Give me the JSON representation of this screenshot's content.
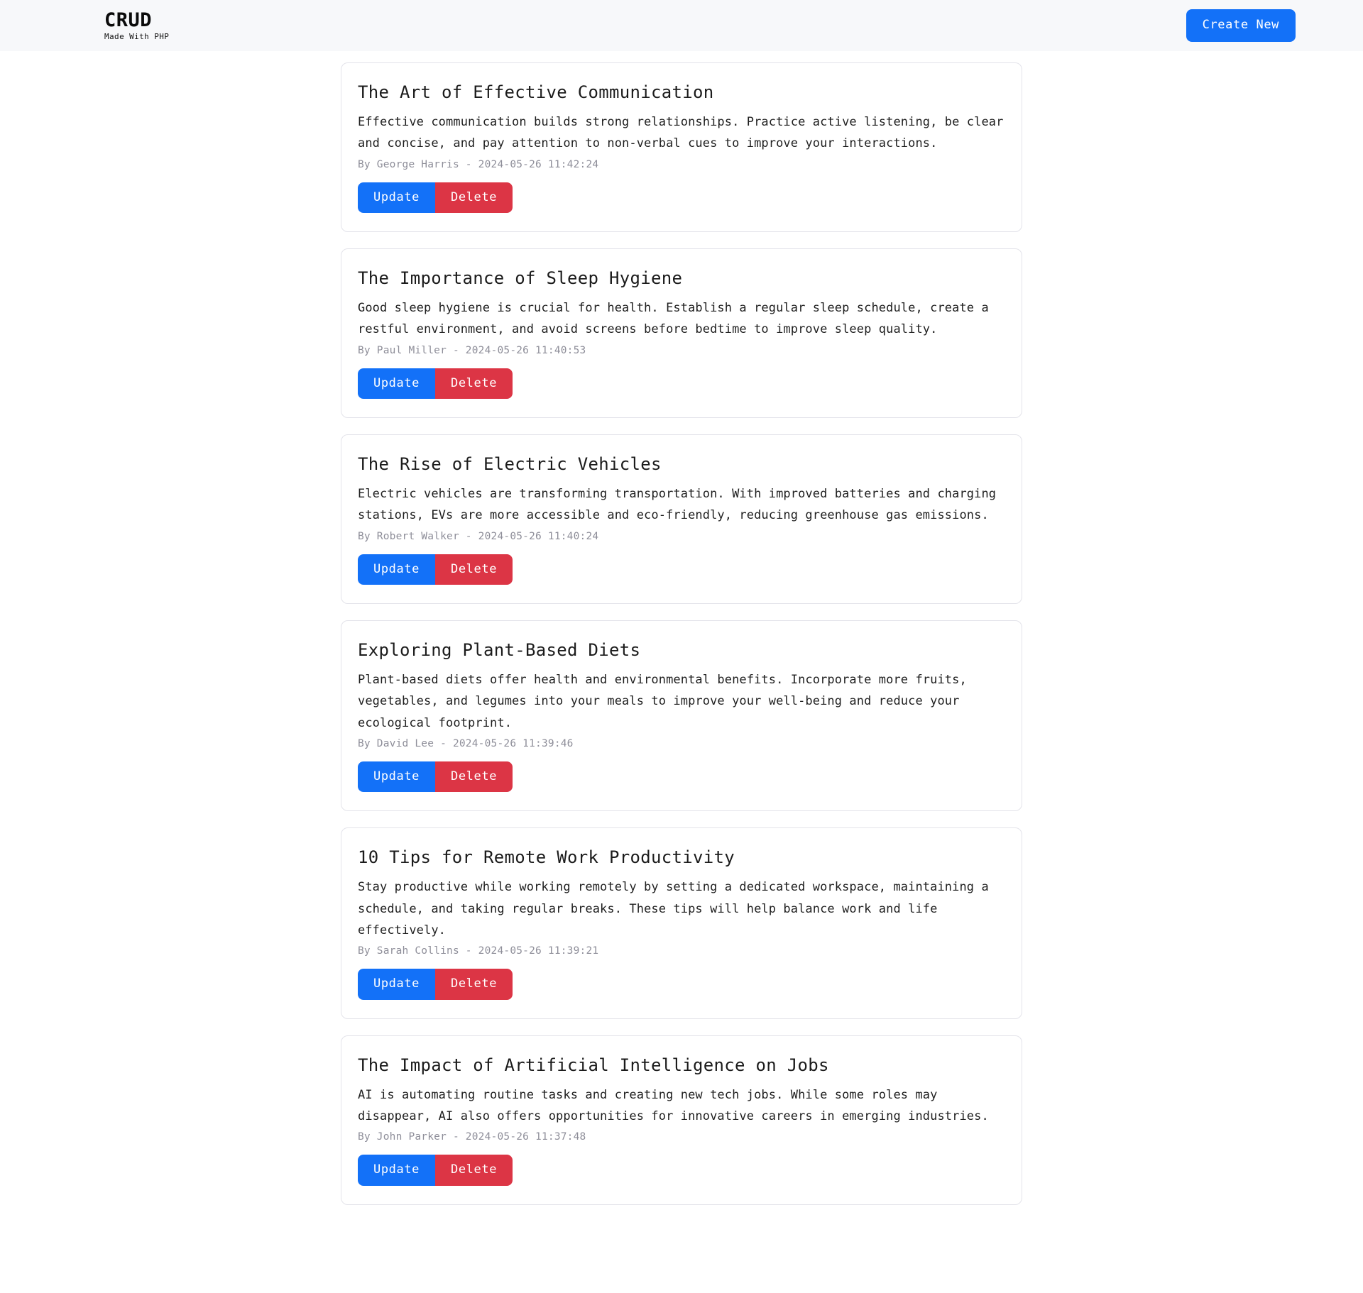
{
  "header": {
    "brand_title": "CRUD",
    "brand_subtitle": "Made With PHP",
    "create_label": "Create New",
    "accent_blue": "#1371f8",
    "danger_red": "#dc3545",
    "bar_background": "#f7f8fa"
  },
  "actions": {
    "update_label": "Update",
    "delete_label": "Delete"
  },
  "posts": [
    {
      "title": "The Art of Effective Communication",
      "body": "Effective communication builds strong relationships. Practice active listening, be clear and concise, and pay attention to non-verbal cues to improve your interactions.",
      "meta": "By George Harris - 2024-05-26 11:42:24",
      "author": "George Harris",
      "timestamp": "2024-05-26 11:42:24"
    },
    {
      "title": "The Importance of Sleep Hygiene",
      "body": "Good sleep hygiene is crucial for health. Establish a regular sleep schedule, create a restful environment, and avoid screens before bedtime to improve sleep quality.",
      "meta": "By Paul Miller - 2024-05-26 11:40:53",
      "author": "Paul Miller",
      "timestamp": "2024-05-26 11:40:53"
    },
    {
      "title": "The Rise of Electric Vehicles",
      "body": "Electric vehicles are transforming transportation. With improved batteries and charging stations, EVs are more accessible and eco-friendly, reducing greenhouse gas emissions.",
      "meta": "By Robert Walker - 2024-05-26 11:40:24",
      "author": "Robert Walker",
      "timestamp": "2024-05-26 11:40:24"
    },
    {
      "title": "Exploring Plant-Based Diets",
      "body": "Plant-based diets offer health and environmental benefits. Incorporate more fruits, vegetables, and legumes into your meals to improve your well-being and reduce your ecological footprint.",
      "meta": "By David Lee - 2024-05-26 11:39:46",
      "author": "David Lee",
      "timestamp": "2024-05-26 11:39:46"
    },
    {
      "title": "10 Tips for Remote Work Productivity",
      "body": "Stay productive while working remotely by setting a dedicated workspace, maintaining a schedule, and taking regular breaks. These tips will help balance work and life effectively.",
      "meta": "By Sarah Collins - 2024-05-26 11:39:21",
      "author": "Sarah Collins",
      "timestamp": "2024-05-26 11:39:21"
    },
    {
      "title": "The Impact of Artificial Intelligence on Jobs",
      "body": "AI is automating routine tasks and creating new tech jobs. While some roles may disappear, AI also offers opportunities for innovative careers in emerging industries.",
      "meta": "By John Parker - 2024-05-26 11:37:48",
      "author": "John Parker",
      "timestamp": "2024-05-26 11:37:48"
    }
  ]
}
